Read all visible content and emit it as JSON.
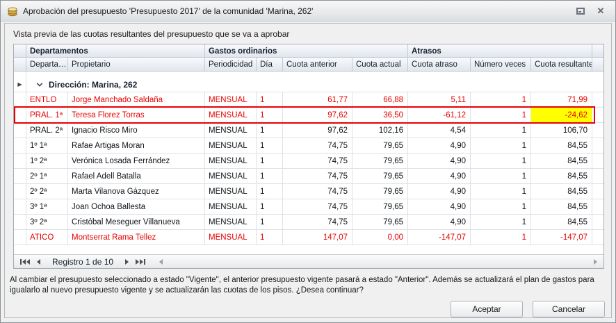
{
  "window": {
    "title": "Aprobación del presupuesto 'Presupuesto 2017' de la comunidad 'Marina, 262'",
    "icons": {
      "app": "coins-icon",
      "restore": "restore-icon",
      "close": "close-icon"
    }
  },
  "preview_label": "Vista previa de las cuotas resultantes del presupuesto que se va a aprobar",
  "grid": {
    "column_groups": {
      "departamentos": "Departamentos",
      "gastos": "Gastos ordinarios",
      "atrasos": "Atrasos"
    },
    "columns": {
      "departamento": "Departa…",
      "propietario": "Propietario",
      "periodicidad": "Periodicidad",
      "dia": "Día",
      "cuota_anterior": "Cuota anterior",
      "cuota_actual": "Cuota actual",
      "cuota_atraso": "Cuota atraso",
      "numero_veces": "Número veces",
      "cuota_resultante": "Cuota resultante"
    },
    "group_row_label": "Dirección: Marina, 262",
    "rows": [
      {
        "departamento": "ENTLO",
        "propietario": "Jorge Manchado Saldaña",
        "periodicidad": "MENSUAL",
        "dia": "1",
        "cuota_anterior": "61,77",
        "cuota_actual": "66,88",
        "cuota_atraso": "5,11",
        "numero_veces": "1",
        "cuota_resultante": "71,99",
        "red": true,
        "selected": false,
        "result_highlight": false
      },
      {
        "departamento": "PRAL. 1ª",
        "propietario": "Teresa Florez Torras",
        "periodicidad": "MENSUAL",
        "dia": "1",
        "cuota_anterior": "97,62",
        "cuota_actual": "36,50",
        "cuota_atraso": "-61,12",
        "numero_veces": "1",
        "cuota_resultante": "-24,62",
        "red": true,
        "selected": true,
        "result_highlight": true
      },
      {
        "departamento": "PRAL. 2ª",
        "propietario": "Ignacio Risco Miro",
        "periodicidad": "MENSUAL",
        "dia": "1",
        "cuota_anterior": "97,62",
        "cuota_actual": "102,16",
        "cuota_atraso": "4,54",
        "numero_veces": "1",
        "cuota_resultante": "106,70",
        "red": false,
        "selected": false,
        "result_highlight": false
      },
      {
        "departamento": "1º 1ª",
        "propietario": "Rafae Artigas Moran",
        "periodicidad": "MENSUAL",
        "dia": "1",
        "cuota_anterior": "74,75",
        "cuota_actual": "79,65",
        "cuota_atraso": "4,90",
        "numero_veces": "1",
        "cuota_resultante": "84,55",
        "red": false,
        "selected": false,
        "result_highlight": false
      },
      {
        "departamento": "1º 2ª",
        "propietario": "Verónica Losada Ferrández",
        "periodicidad": "MENSUAL",
        "dia": "1",
        "cuota_anterior": "74,75",
        "cuota_actual": "79,65",
        "cuota_atraso": "4,90",
        "numero_veces": "1",
        "cuota_resultante": "84,55",
        "red": false,
        "selected": false,
        "result_highlight": false
      },
      {
        "departamento": "2º 1ª",
        "propietario": "Rafael Adell Batalla",
        "periodicidad": "MENSUAL",
        "dia": "1",
        "cuota_anterior": "74,75",
        "cuota_actual": "79,65",
        "cuota_atraso": "4,90",
        "numero_veces": "1",
        "cuota_resultante": "84,55",
        "red": false,
        "selected": false,
        "result_highlight": false
      },
      {
        "departamento": "2º 2ª",
        "propietario": "Marta Vilanova Gázquez",
        "periodicidad": "MENSUAL",
        "dia": "1",
        "cuota_anterior": "74,75",
        "cuota_actual": "79,65",
        "cuota_atraso": "4,90",
        "numero_veces": "1",
        "cuota_resultante": "84,55",
        "red": false,
        "selected": false,
        "result_highlight": false
      },
      {
        "departamento": "3º 1ª",
        "propietario": "Joan Ochoa Ballesta",
        "periodicidad": "MENSUAL",
        "dia": "1",
        "cuota_anterior": "74,75",
        "cuota_actual": "79,65",
        "cuota_atraso": "4,90",
        "numero_veces": "1",
        "cuota_resultante": "84,55",
        "red": false,
        "selected": false,
        "result_highlight": false
      },
      {
        "departamento": "3º 2ª",
        "propietario": "Cristóbal Meseguer Villanueva",
        "periodicidad": "MENSUAL",
        "dia": "1",
        "cuota_anterior": "74,75",
        "cuota_actual": "79,65",
        "cuota_atraso": "4,90",
        "numero_veces": "1",
        "cuota_resultante": "84,55",
        "red": false,
        "selected": false,
        "result_highlight": false
      },
      {
        "departamento": "ATICO",
        "propietario": "Montserrat Rama Tellez",
        "periodicidad": "MENSUAL",
        "dia": "1",
        "cuota_anterior": "147,07",
        "cuota_actual": "0,00",
        "cuota_atraso": "-147,07",
        "numero_veces": "1",
        "cuota_resultante": "-147,07",
        "red": true,
        "selected": false,
        "result_highlight": false
      }
    ],
    "nav": {
      "record_label": "Registro 1 de 10"
    }
  },
  "footer": {
    "message": "Al cambiar el presupuesto seleccionado a estado \"Vigente\", el anterior presupuesto vigente pasará a estado \"Anterior\". Además se actualizará el plan de gastos para igualarlo al nuevo presupuesto vigente y se actualizarán las cuotas de los pisos. ¿Desea continuar?",
    "buttons": {
      "accept": "Aceptar",
      "cancel": "Cancelar"
    }
  },
  "colors": {
    "accent_red": "#e80000",
    "highlight_yellow": "#ffff00",
    "header_text": "#15202e"
  }
}
